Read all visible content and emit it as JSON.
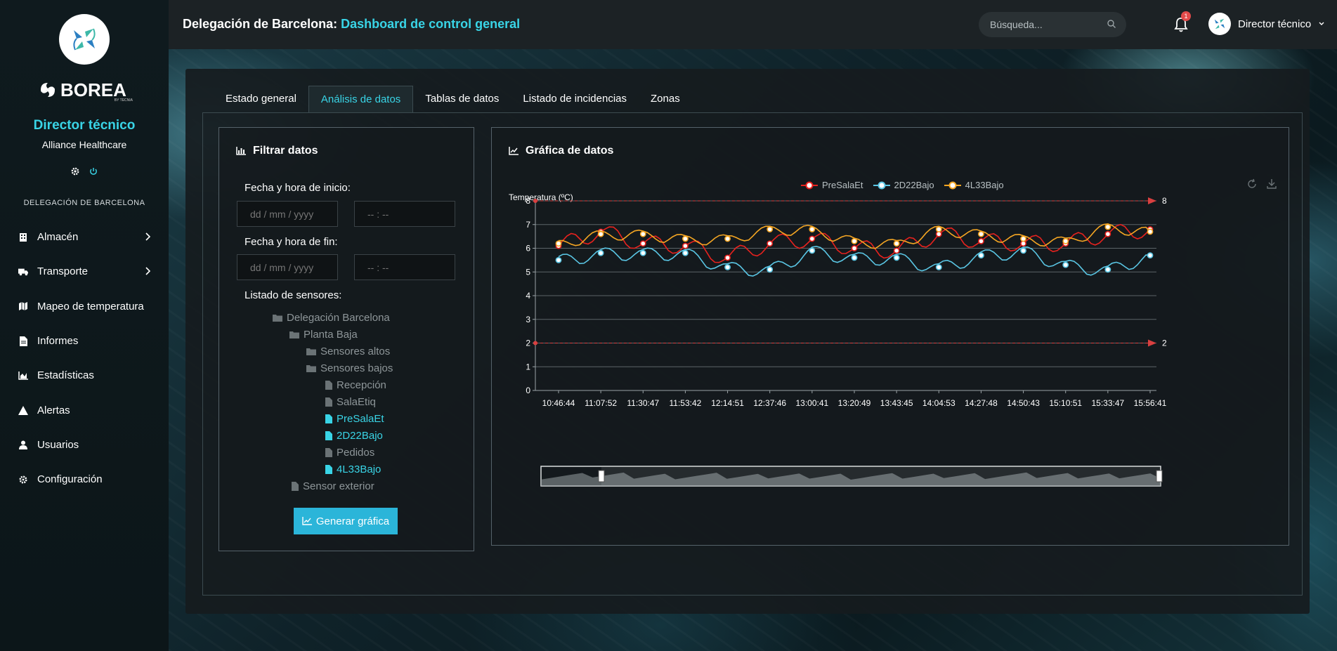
{
  "header": {
    "title_prefix": "Delegación de Barcelona:",
    "title_accent": "Dashboard de control general",
    "search_placeholder": "Búsqueda...",
    "notifications_count": "1",
    "user_name": "Director técnico"
  },
  "sidebar": {
    "brand": "BOREA",
    "brand_sub": "BY TECNIA",
    "role": "Director técnico",
    "company": "Alliance Healthcare",
    "section": "DELEGACIÓN DE BARCELONA",
    "items": [
      {
        "label": "Almacén",
        "icon": "building-icon",
        "has_submenu": true
      },
      {
        "label": "Transporte",
        "icon": "truck-icon",
        "has_submenu": true
      },
      {
        "label": "Mapeo de temperatura",
        "icon": "map-icon",
        "has_submenu": false
      },
      {
        "label": "Informes",
        "icon": "file-icon",
        "has_submenu": false
      },
      {
        "label": "Estadísticas",
        "icon": "area-chart-icon",
        "has_submenu": false
      },
      {
        "label": "Alertas",
        "icon": "warning-icon",
        "has_submenu": false
      },
      {
        "label": "Usuarios",
        "icon": "user-icon",
        "has_submenu": false
      },
      {
        "label": "Configuración",
        "icon": "gear-icon",
        "has_submenu": false
      }
    ]
  },
  "tabs": [
    {
      "label": "Estado general",
      "active": false
    },
    {
      "label": "Análisis de datos",
      "active": true
    },
    {
      "label": "Tablas de datos",
      "active": false
    },
    {
      "label": "Listado de incidencias",
      "active": false
    },
    {
      "label": "Zonas",
      "active": false
    }
  ],
  "filter": {
    "title": "Filtrar datos",
    "start_label": "Fecha y hora de inicio:",
    "end_label": "Fecha y hora de fin:",
    "date_placeholder": "dd / mm / yyyy",
    "time_placeholder": "-- : --",
    "sensors_label": "Listado de sensores:",
    "tree": [
      {
        "label": "Delegación Barcelona",
        "type": "folder",
        "selected": false
      },
      {
        "label": "Planta Baja",
        "type": "folder",
        "selected": false
      },
      {
        "label": "Sensores altos",
        "type": "folder",
        "selected": false
      },
      {
        "label": "Sensores bajos",
        "type": "folder",
        "selected": false
      },
      {
        "label": "Recepción",
        "type": "file",
        "selected": false
      },
      {
        "label": "SalaEtiq",
        "type": "file",
        "selected": false
      },
      {
        "label": "PreSalaEt",
        "type": "file",
        "selected": true
      },
      {
        "label": "2D22Bajo",
        "type": "file",
        "selected": true
      },
      {
        "label": "Pedidos",
        "type": "file",
        "selected": false
      },
      {
        "label": "4L33Bajo",
        "type": "file",
        "selected": true
      },
      {
        "label": "Sensor exterior",
        "type": "file",
        "selected": false
      }
    ],
    "button_label": "Generar gráfica"
  },
  "graph": {
    "title": "Gráfica de datos"
  },
  "chart_data": {
    "type": "line",
    "ylabel": "Temperatura (ºC)",
    "ylim": [
      0,
      8
    ],
    "yticks": [
      0,
      1,
      2,
      3,
      4,
      5,
      6,
      7,
      8
    ],
    "x": [
      "10:46:44",
      "11:07:52",
      "11:30:47",
      "11:53:42",
      "12:14:51",
      "12:37:46",
      "13:00:41",
      "13:20:49",
      "13:43:45",
      "14:04:53",
      "14:27:48",
      "14:50:43",
      "15:10:51",
      "15:33:47",
      "15:56:41"
    ],
    "thresholds": [
      {
        "value": 8,
        "label": "8"
      },
      {
        "value": 2,
        "label": "2"
      }
    ],
    "series": [
      {
        "name": "PreSalaEt",
        "color": "#e8221e",
        "values": [
          6.1,
          6.7,
          6.2,
          6.1,
          5.6,
          6.2,
          6.4,
          6.0,
          5.9,
          6.6,
          6.3,
          6.2,
          6.2,
          6.6,
          6.8
        ]
      },
      {
        "name": "2D22Bajo",
        "color": "#5ac6e4",
        "values": [
          5.5,
          5.8,
          5.8,
          5.8,
          5.2,
          5.1,
          5.9,
          5.6,
          5.6,
          5.2,
          5.7,
          5.9,
          5.3,
          5.1,
          5.7
        ]
      },
      {
        "name": "4L33Bajo",
        "color": "#f5a623",
        "values": [
          6.2,
          6.6,
          6.6,
          6.4,
          6.4,
          6.8,
          6.8,
          6.3,
          6.2,
          6.8,
          6.6,
          6.4,
          6.3,
          6.9,
          6.7
        ]
      }
    ],
    "legend_position": "top-center",
    "grid": true
  }
}
